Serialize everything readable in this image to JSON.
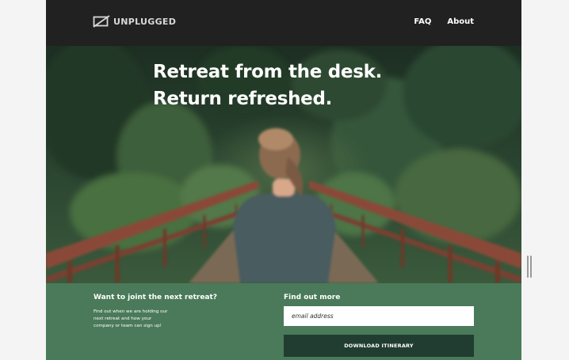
{
  "header": {
    "logo_text": "UNPLUGGED",
    "nav": [
      {
        "label": "FAQ"
      },
      {
        "label": "About"
      }
    ]
  },
  "hero": {
    "title_line1": "Retreat from the desk.",
    "title_line2": "Return refreshed."
  },
  "signup": {
    "heading": "Want to joint the next retreat?",
    "description": "Find out when we are holding our next retreat and how your company or team can sign up!"
  },
  "find_out": {
    "heading": "Find out more",
    "email_placeholder": "email address",
    "download_label": "DOWNLOAD ITINERARY"
  },
  "colors": {
    "header_bg": "#212121",
    "footer_bg": "#4a7a59",
    "button_bg": "#213d31"
  }
}
